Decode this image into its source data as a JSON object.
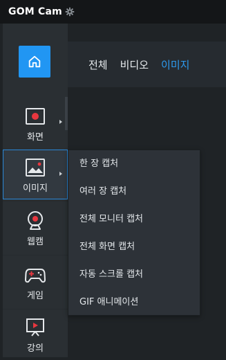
{
  "app": {
    "logo_main": "GOM",
    "logo_sub": "Cam",
    "gear_icon": "gear-icon"
  },
  "topbar": {
    "tabs": [
      {
        "label": "전체",
        "active": false
      },
      {
        "label": "비디오",
        "active": false
      },
      {
        "label": "이미지",
        "active": true
      }
    ]
  },
  "sidebar": {
    "home_icon": "home-icon",
    "items": [
      {
        "label": "화면",
        "icon": "screen-record-icon",
        "has_submenu": true
      },
      {
        "label": "이미지",
        "icon": "image-icon",
        "has_submenu": true,
        "active": true
      },
      {
        "label": "웹캠",
        "icon": "webcam-icon",
        "has_submenu": false
      },
      {
        "label": "게임",
        "icon": "gamepad-icon",
        "has_submenu": false
      },
      {
        "label": "강의",
        "icon": "lecture-icon",
        "has_submenu": false
      }
    ]
  },
  "submenu": {
    "items": [
      {
        "label": "한 장 캡처"
      },
      {
        "label": "여러 장 캡처"
      },
      {
        "label": "전체 모니터 캡처"
      },
      {
        "label": "전체 화면 캡처"
      },
      {
        "label": "자동 스크롤 캡처"
      },
      {
        "label": "GIF 애니메이션"
      }
    ]
  },
  "colors": {
    "accent": "#2196f3",
    "active_tab": "#2d9bf0",
    "record_red": "#e8373f",
    "background": "#1f2326",
    "sidebar": "#2a2f33",
    "titlebar": "#141618"
  }
}
